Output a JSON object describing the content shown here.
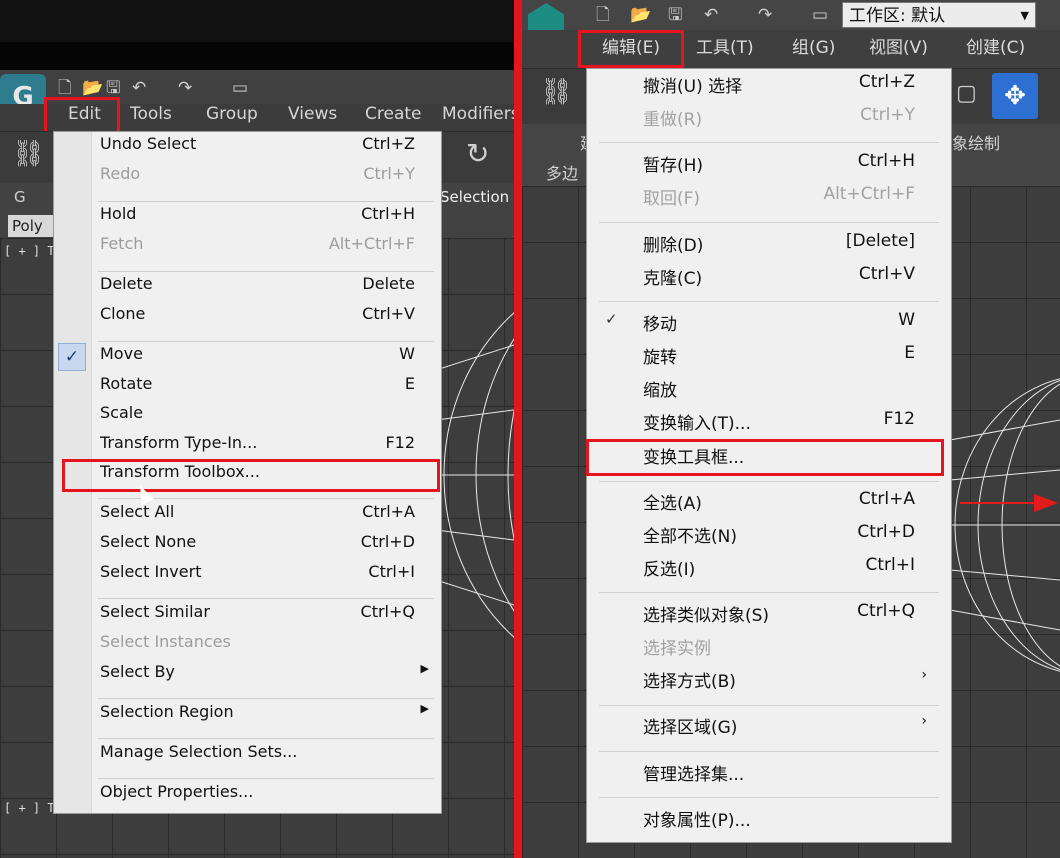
{
  "left": {
    "menubar": [
      "Edit",
      "Tools",
      "Group",
      "Views",
      "Create",
      "Modifiers"
    ],
    "ribbon_tabs": [
      "G",
      "Poly",
      "Selection"
    ],
    "viewport_labels": [
      "[ + ] T",
      "[ + ] T"
    ],
    "items": [
      {
        "label": "Undo Select",
        "shortcut": "Ctrl+Z",
        "disabled": false
      },
      {
        "label": "Redo",
        "shortcut": "Ctrl+Y",
        "disabled": true
      },
      {
        "label": "Hold",
        "shortcut": "Ctrl+H",
        "disabled": false
      },
      {
        "label": "Fetch",
        "shortcut": "Alt+Ctrl+F",
        "disabled": true
      },
      {
        "label": "Delete",
        "shortcut": "Delete",
        "disabled": false
      },
      {
        "label": "Clone",
        "shortcut": "Ctrl+V",
        "disabled": false
      },
      {
        "label": "Move",
        "shortcut": "W",
        "disabled": false,
        "checked": true
      },
      {
        "label": "Rotate",
        "shortcut": "E",
        "disabled": false
      },
      {
        "label": "Scale",
        "shortcut": "",
        "disabled": false
      },
      {
        "label": "Transform Type-In...",
        "shortcut": "F12",
        "disabled": false
      },
      {
        "label": "Transform Toolbox...",
        "shortcut": "",
        "disabled": false,
        "highlighted": true
      },
      {
        "label": "Select All",
        "shortcut": "Ctrl+A",
        "disabled": false
      },
      {
        "label": "Select None",
        "shortcut": "Ctrl+D",
        "disabled": false
      },
      {
        "label": "Select Invert",
        "shortcut": "Ctrl+I",
        "disabled": false
      },
      {
        "label": "Select Similar",
        "shortcut": "Ctrl+Q",
        "disabled": false
      },
      {
        "label": "Select Instances",
        "shortcut": "",
        "disabled": true
      },
      {
        "label": "Select By",
        "shortcut": "",
        "disabled": false,
        "submenu": true
      },
      {
        "label": "Selection Region",
        "shortcut": "",
        "disabled": false,
        "submenu": true
      },
      {
        "label": "Manage Selection Sets...",
        "shortcut": "",
        "disabled": false
      },
      {
        "label": "Object Properties...",
        "shortcut": "",
        "disabled": false
      }
    ]
  },
  "right": {
    "workspace_label": "工作区: 默认",
    "menubar": [
      "编辑(E)",
      "工具(T)",
      "组(G)",
      "视图(V)",
      "创建(C)"
    ],
    "ribbon_text": [
      "建",
      "多边",
      "象绘制"
    ],
    "items": [
      {
        "label": "撤消(U) 选择",
        "shortcut": "Ctrl+Z",
        "disabled": false
      },
      {
        "label": "重做(R)",
        "shortcut": "Ctrl+Y",
        "disabled": true
      },
      {
        "label": "暂存(H)",
        "shortcut": "Ctrl+H",
        "disabled": false
      },
      {
        "label": "取回(F)",
        "shortcut": "Alt+Ctrl+F",
        "disabled": true
      },
      {
        "label": "删除(D)",
        "shortcut": "[Delete]",
        "disabled": false
      },
      {
        "label": "克隆(C)",
        "shortcut": "Ctrl+V",
        "disabled": false
      },
      {
        "label": "移动",
        "shortcut": "W",
        "disabled": false,
        "checked": true
      },
      {
        "label": "旋转",
        "shortcut": "E",
        "disabled": false
      },
      {
        "label": "缩放",
        "shortcut": "",
        "disabled": false
      },
      {
        "label": "变换输入(T)...",
        "shortcut": "F12",
        "disabled": false
      },
      {
        "label": "变换工具框...",
        "shortcut": "",
        "disabled": false,
        "highlighted": true
      },
      {
        "label": "全选(A)",
        "shortcut": "Ctrl+A",
        "disabled": false
      },
      {
        "label": "全部不选(N)",
        "shortcut": "Ctrl+D",
        "disabled": false
      },
      {
        "label": "反选(I)",
        "shortcut": "Ctrl+I",
        "disabled": false
      },
      {
        "label": "选择类似对象(S)",
        "shortcut": "Ctrl+Q",
        "disabled": false
      },
      {
        "label": "选择实例",
        "shortcut": "",
        "disabled": true
      },
      {
        "label": "选择方式(B)",
        "shortcut": "",
        "disabled": false,
        "submenu": true
      },
      {
        "label": "选择区域(G)",
        "shortcut": "",
        "disabled": false,
        "submenu": true
      },
      {
        "label": "管理选择集...",
        "shortcut": "",
        "disabled": false
      },
      {
        "label": "对象属性(P)...",
        "shortcut": "",
        "disabled": false
      }
    ]
  },
  "colors": {
    "highlight_red": "#e5151f",
    "menu_bg": "#f0f0f0",
    "app_dark": "#3c3c3c",
    "move_blue": "#2e6fd3"
  },
  "icons": [
    "app-logo-icon",
    "new-file-icon",
    "open-folder-icon",
    "save-icon",
    "undo-icon",
    "redo-icon",
    "project-icon",
    "link-icon",
    "rotate-icon",
    "move-icon",
    "check-icon",
    "submenu-arrow-icon",
    "cursor-icon"
  ]
}
